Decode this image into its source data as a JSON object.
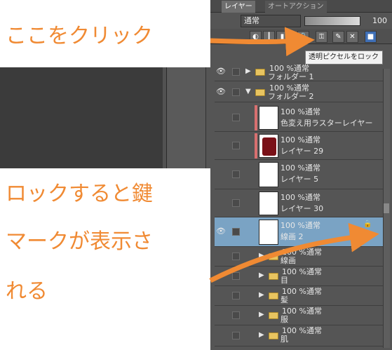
{
  "panel": {
    "tabs": [
      {
        "label": "レイヤー",
        "active": true
      },
      {
        "label": "オートアクション",
        "active": false
      }
    ],
    "blend_mode": "通常",
    "opacity": "100",
    "tooltip": "透明ピクセルをロック"
  },
  "layers": [
    {
      "kind": "folder",
      "line1": "100 %通常",
      "line2": "フォルダー 1",
      "visible": true
    },
    {
      "kind": "folder-open",
      "line1": "100 %通常",
      "line2": "フォルダー 2",
      "visible": true
    },
    {
      "kind": "raster",
      "line1": "100 %通常",
      "line2": "色変え用ラスターレイヤー",
      "visible": false
    },
    {
      "kind": "raster",
      "line1": "100 %通常",
      "line2": "レイヤー 29",
      "visible": false
    },
    {
      "kind": "raster",
      "line1": "100 %通常",
      "line2": "レイヤー 5",
      "visible": false
    },
    {
      "kind": "raster",
      "line1": "100 %通常",
      "line2": "レイヤー 30",
      "visible": false
    },
    {
      "kind": "raster",
      "line1": "100 %通常",
      "line2": "線画 2",
      "visible": true,
      "selected": true
    },
    {
      "kind": "folder",
      "line1": "100 %通常",
      "line2": "線画",
      "visible": false
    },
    {
      "kind": "folder",
      "line1": "100 %通常",
      "line2": "目",
      "visible": false
    },
    {
      "kind": "folder",
      "line1": "100 %通常",
      "line2": "髪",
      "visible": false
    },
    {
      "kind": "folder",
      "line1": "100 %通常",
      "line2": "服",
      "visible": false
    },
    {
      "kind": "folder",
      "line1": "100 %通常",
      "line2": "肌",
      "visible": false
    }
  ],
  "callouts": {
    "top": "ここをクリック",
    "bottom_lines": [
      "ロックすると鍵",
      "マークが表示さ",
      "れる"
    ]
  },
  "colors": {
    "annotation": "#f08a33",
    "selected_row": "#7aa3c4"
  },
  "icons": {
    "eye": "eye-icon",
    "lock": "lock-icon",
    "folder": "folder-icon"
  }
}
